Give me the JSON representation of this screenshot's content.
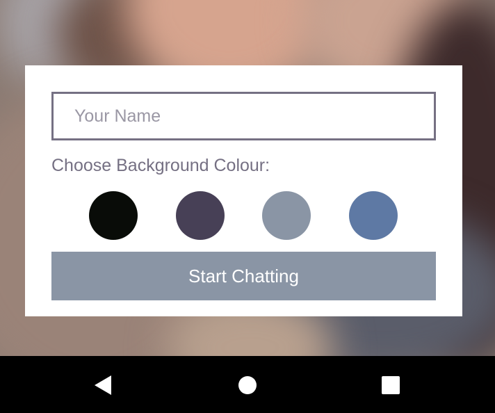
{
  "form": {
    "name_placeholder": "Your Name",
    "name_value": "",
    "background_label": "Choose Background Colour:",
    "colors": [
      {
        "name": "black",
        "hex": "#090C08"
      },
      {
        "name": "dark-purple",
        "hex": "#474056"
      },
      {
        "name": "grey-blue",
        "hex": "#8A95A5"
      },
      {
        "name": "blue",
        "hex": "#5E79A4"
      }
    ],
    "start_button_label": "Start Chatting",
    "start_button_color": "#8A95A5",
    "text_color": "#757083"
  },
  "navbar": {
    "icons": [
      "back-icon",
      "home-icon",
      "recents-icon"
    ]
  }
}
